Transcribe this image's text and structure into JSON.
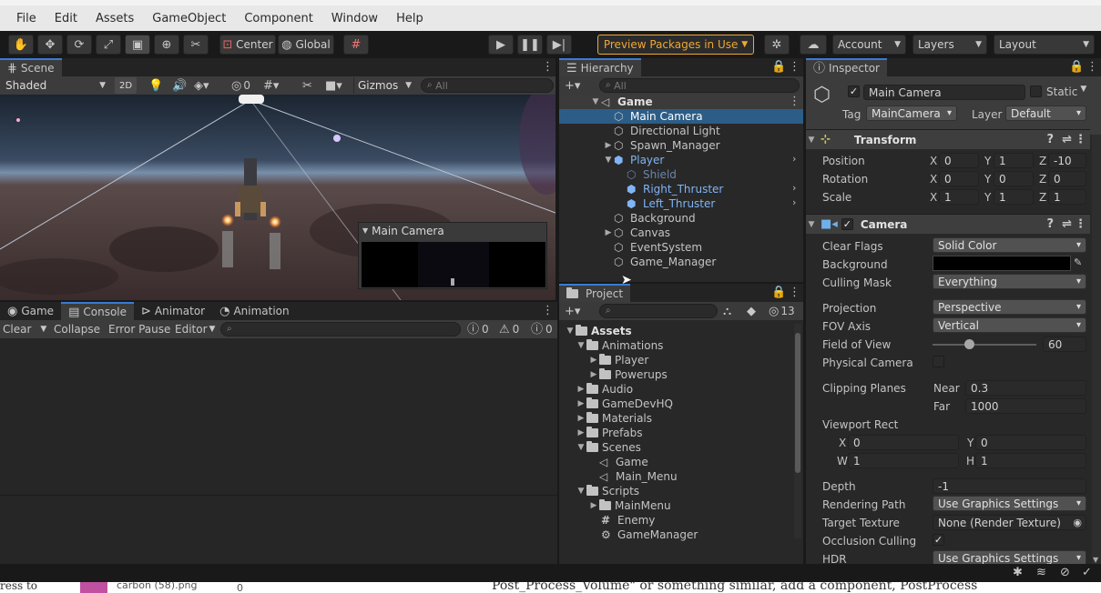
{
  "menu": [
    "File",
    "Edit",
    "Assets",
    "GameObject",
    "Component",
    "Window",
    "Help"
  ],
  "toolbar": {
    "center_label": "Center",
    "global_label": "Global",
    "preview_packages": "Preview Packages in Use",
    "account": "Account",
    "layers": "Layers",
    "layout": "Layout",
    "accent": "#f0a732"
  },
  "scene": {
    "tab": "Scene",
    "shading": "Shaded",
    "mode_2d": "2D",
    "hidden_count": "0",
    "gizmos": "Gizmos",
    "search_placeholder": "All",
    "preview_title": "Main Camera"
  },
  "bottom": {
    "tabs": [
      "Game",
      "Console",
      "Animator",
      "Animation"
    ],
    "clear": "Clear",
    "collapse": "Collapse",
    "error_pause": "Error Pause",
    "editor": "Editor",
    "log_count": "0",
    "warn_count": "0",
    "error_count": "0"
  },
  "hierarchy": {
    "tab": "Hierarchy",
    "search_placeholder": "All",
    "items": [
      "Game",
      "Main Camera",
      "Directional Light",
      "Spawn_Manager",
      "Player",
      "Shield",
      "Right_Thruster",
      "Left_Thruster",
      "Background",
      "Canvas",
      "EventSystem",
      "Game_Manager"
    ]
  },
  "project": {
    "tab": "Project",
    "hidden_count": "13",
    "items": [
      "Assets",
      "Animations",
      "Player",
      "Powerups",
      "Audio",
      "GameDevHQ",
      "Materials",
      "Prefabs",
      "Scenes",
      "Game",
      "Main_Menu",
      "Scripts",
      "MainMenu",
      "Enemy",
      "GameManager"
    ]
  },
  "inspector": {
    "tab": "Inspector",
    "object_name": "Main Camera",
    "static_label": "Static",
    "tag_label": "Tag",
    "tag_value": "MainCamera",
    "layer_label": "Layer",
    "layer_value": "Default",
    "transform": {
      "title": "Transform",
      "position_label": "Position",
      "rotation_label": "Rotation",
      "scale_label": "Scale",
      "position": [
        "0",
        "1",
        "-10"
      ],
      "rotation": [
        "0",
        "0",
        "0"
      ],
      "scale": [
        "1",
        "1",
        "1"
      ],
      "axes": [
        "X",
        "Y",
        "Z"
      ]
    },
    "camera": {
      "title": "Camera",
      "clear_flags_label": "Clear Flags",
      "clear_flags": "Solid Color",
      "background_label": "Background",
      "background_color": "#000000",
      "culling_mask_label": "Culling Mask",
      "culling_mask": "Everything",
      "projection_label": "Projection",
      "projection": "Perspective",
      "fov_axis_label": "FOV Axis",
      "fov_axis": "Vertical",
      "fov_label": "Field of View",
      "fov": "60",
      "physical_label": "Physical Camera",
      "clipping_label": "Clipping Planes",
      "near_label": "Near",
      "near": "0.3",
      "far_label": "Far",
      "far": "1000",
      "viewport_label": "Viewport Rect",
      "vx_label": "X",
      "vx": "0",
      "vy_label": "Y",
      "vy": "0",
      "vw_label": "W",
      "vw": "1",
      "vh_label": "H",
      "vh": "1",
      "depth_label": "Depth",
      "depth": "-1",
      "rendering_path_label": "Rendering Path",
      "rendering_path": "Use Graphics Settings",
      "target_texture_label": "Target Texture",
      "target_texture": "None (Render Texture)",
      "occlusion_label": "Occlusion Culling",
      "hdr_label": "HDR",
      "hdr": "Use Graphics Settings"
    }
  },
  "below": {
    "left_text": "ress to",
    "file_name": "carbon (58).png",
    "file_size": "0",
    "right_text": "Post_Process_Volume\" or something similar, add a component, PostProcess"
  }
}
